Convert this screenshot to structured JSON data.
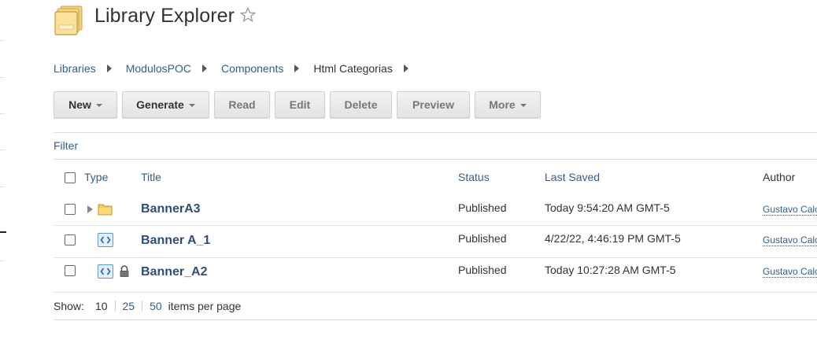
{
  "header": {
    "title": "Library Explorer"
  },
  "breadcrumb": [
    "Libraries",
    "ModulosPOC",
    "Components",
    "Html Categorias"
  ],
  "toolbar": {
    "new_label": "New",
    "generate_label": "Generate",
    "read_label": "Read",
    "edit_label": "Edit",
    "delete_label": "Delete",
    "preview_label": "Preview",
    "more_label": "More"
  },
  "filter_label": "Filter",
  "table": {
    "headers": {
      "type": "Type",
      "title": "Title",
      "status": "Status",
      "last_saved": "Last Saved",
      "author": "Author"
    },
    "rows": [
      {
        "title": "BannerA3",
        "type_icon": "folder-icon",
        "status": "Published",
        "last_saved": "Today 9:54:20 AM GMT-5",
        "author": "Gustavo Calc"
      },
      {
        "title": "Banner A_1",
        "type_icon": "html-code-icon",
        "status": "Published",
        "last_saved": "4/22/22, 4:46:19 PM GMT-5",
        "author": "Gustavo Calc"
      },
      {
        "title": "Banner_A2",
        "type_icon": "html-code-icon",
        "locked": true,
        "status": "Published",
        "last_saved": "Today 10:27:28 AM GMT-5",
        "author": "Gustavo Calc"
      }
    ]
  },
  "paging": {
    "show_label": "Show:",
    "current": "10",
    "options": [
      "25",
      "50"
    ],
    "suffix": "items per page"
  },
  "colors": {
    "link": "#2f5f8e",
    "title_link": "#2f4f7a",
    "button_bg": "#e8e8e8",
    "folder": "#f5c85a",
    "code_icon": "#5b9bd5"
  }
}
